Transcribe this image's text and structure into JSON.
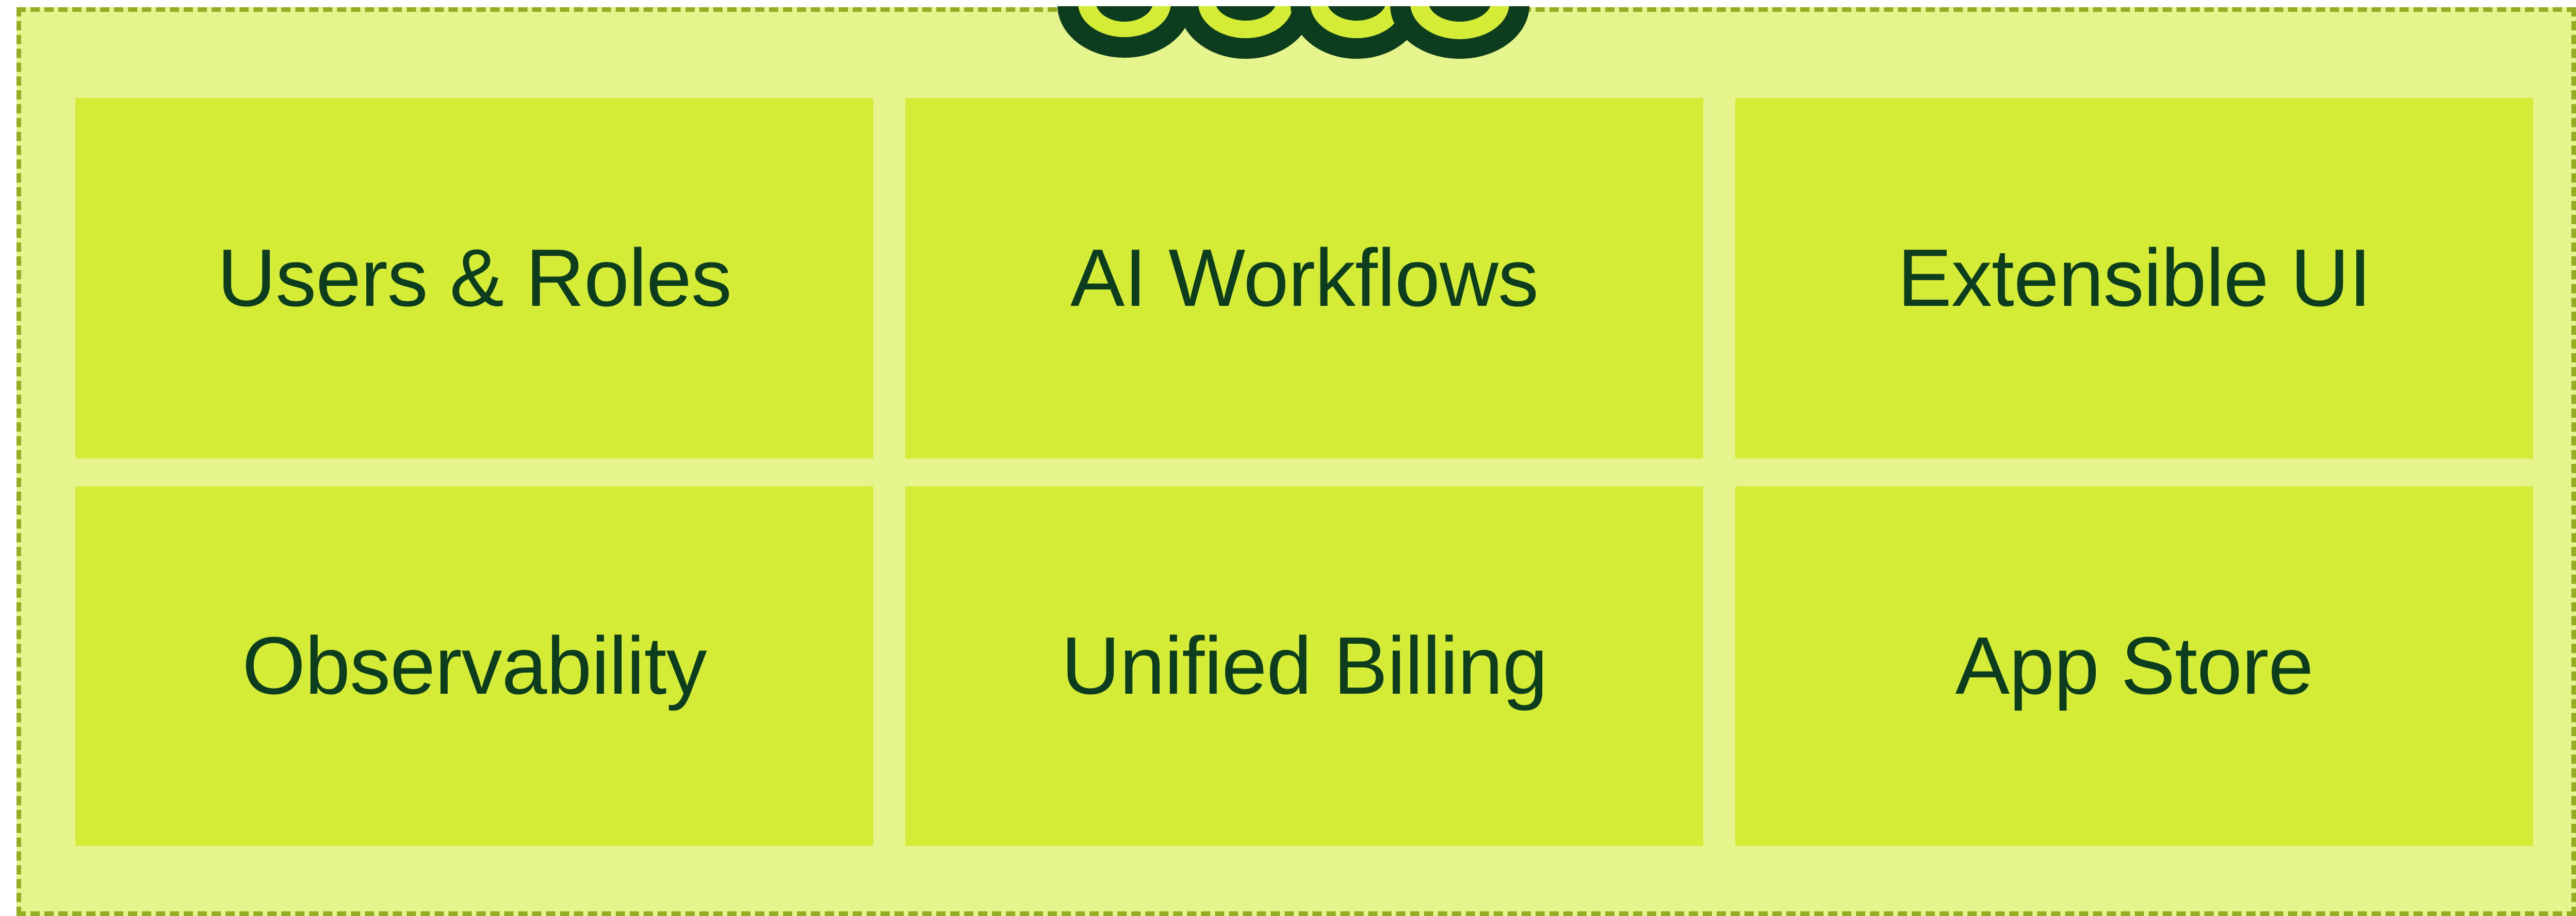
{
  "logo": {
    "icon": "brand-logo-icon",
    "colors": {
      "outline": "#0b3d1e",
      "fill": "#d4ec35"
    }
  },
  "colors": {
    "frame_background": "#e6f48d",
    "frame_border": "#94ad22",
    "tile_background": "#d4ec35",
    "tile_text": "#0b3d1e"
  },
  "features": [
    {
      "label": "Users & Roles"
    },
    {
      "label": "AI Workflows"
    },
    {
      "label": "Extensible UI"
    },
    {
      "label": "Observability"
    },
    {
      "label": "Unified Billing"
    },
    {
      "label": "App Store"
    }
  ]
}
